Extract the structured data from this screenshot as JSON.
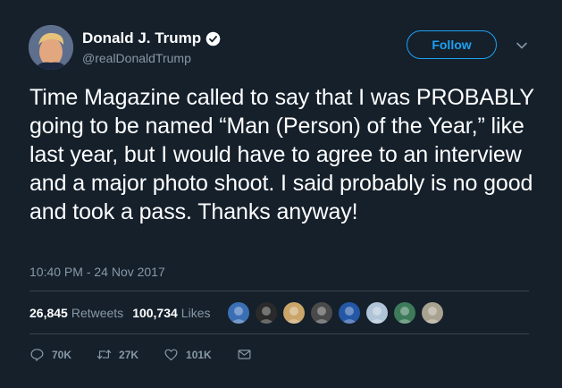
{
  "user": {
    "name": "Donald J. Trump",
    "handle": "@realDonaldTrump"
  },
  "follow_label": "Follow",
  "tweet": {
    "text": "Time Magazine called to say that I was PROBABLY going to be named “Man (Person) of the Year,” like last year, but I would have to agree to an interview and a major photo shoot. I said probably is no good and took a pass. Thanks anyway!",
    "timestamp": "10:40 PM - 24 Nov 2017"
  },
  "stats": {
    "retweets_count": "26,845",
    "retweets_label": "Retweets",
    "likes_count": "100,734",
    "likes_label": "Likes"
  },
  "likers": [
    {
      "icon": "liker-avatar",
      "color": "#3b6fb5"
    },
    {
      "icon": "liker-avatar",
      "color": "#2a2a2a"
    },
    {
      "icon": "liker-avatar",
      "color": "#c9a56a"
    },
    {
      "icon": "liker-avatar",
      "color": "#4a4a4a"
    },
    {
      "icon": "liker-avatar",
      "color": "#2457a6"
    },
    {
      "icon": "liker-avatar",
      "color": "#b0c4d8"
    },
    {
      "icon": "liker-avatar",
      "color": "#3d7a5a"
    },
    {
      "icon": "liker-avatar",
      "color": "#a8a290"
    }
  ],
  "actions": {
    "replies": "70K",
    "retweets": "27K",
    "likes": "101K"
  },
  "colors": {
    "background": "#15202b",
    "accent": "#1da1f2",
    "secondary_text": "#8899a6",
    "divider": "#38444d"
  }
}
